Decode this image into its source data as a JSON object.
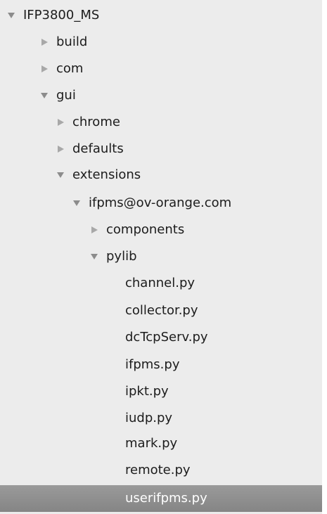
{
  "tree": {
    "items": [
      {
        "label": "IFP3800_MS",
        "state": "expanded"
      },
      {
        "label": "build",
        "state": "collapsed"
      },
      {
        "label": "com",
        "state": "collapsed"
      },
      {
        "label": "gui",
        "state": "expanded"
      },
      {
        "label": "chrome",
        "state": "collapsed"
      },
      {
        "label": "defaults",
        "state": "collapsed"
      },
      {
        "label": "extensions",
        "state": "expanded"
      },
      {
        "label": "ifpms@ov-orange.com",
        "state": "expanded"
      },
      {
        "label": "components",
        "state": "collapsed"
      },
      {
        "label": "pylib",
        "state": "expanded"
      },
      {
        "label": "channel.py",
        "state": "file"
      },
      {
        "label": "collector.py",
        "state": "file"
      },
      {
        "label": "dcTcpServ.py",
        "state": "file"
      },
      {
        "label": "ifpms.py",
        "state": "file"
      },
      {
        "label": "ipkt.py",
        "state": "file"
      },
      {
        "label": "iudp.py",
        "state": "file"
      },
      {
        "label": "mark.py",
        "state": "file"
      },
      {
        "label": "remote.py",
        "state": "file"
      },
      {
        "label": "userifpms.py",
        "state": "file",
        "selected": true
      }
    ],
    "selection_color": "#8f8f8f",
    "background_color": "#ececec"
  }
}
